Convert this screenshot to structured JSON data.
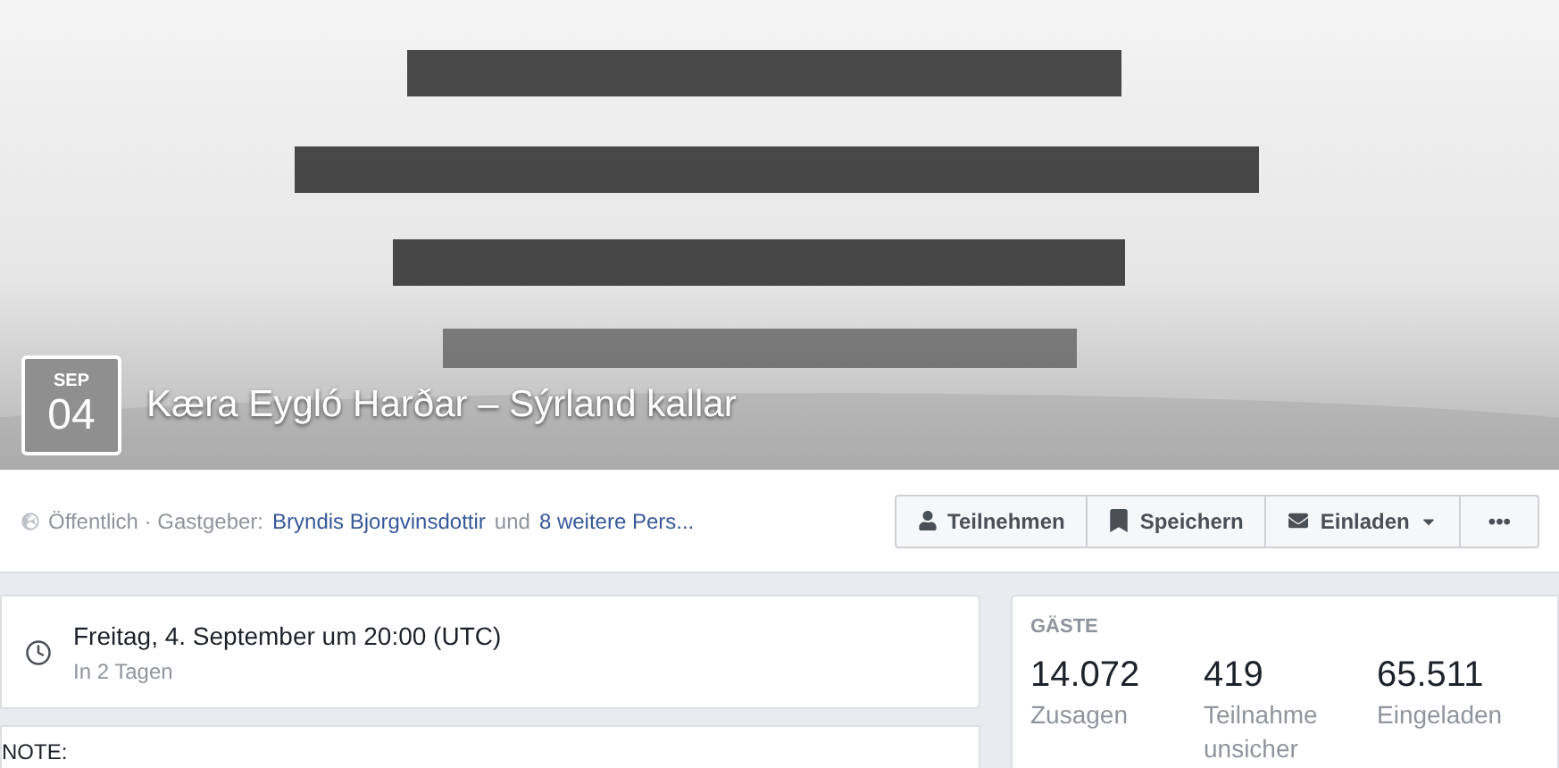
{
  "event": {
    "month": "SEP",
    "day": "04",
    "title": "Kæra Eygló Harðar – Sýrland kallar"
  },
  "info": {
    "privacy": "Öffentlich · Gastgeber:",
    "host": "Bryndis Bjorgvinsdottir",
    "joiner": "und",
    "others": "8 weitere Pers..."
  },
  "actions": [
    {
      "kind": "join",
      "label": "Teilnehmen"
    },
    {
      "kind": "save",
      "label": "Speichern"
    },
    {
      "kind": "invite",
      "label": "Einladen"
    },
    {
      "kind": "more",
      "label": "•••"
    }
  ],
  "time": {
    "date": "Freitag, 4. September um 20:00 (UTC)",
    "relative": "In 2 Tagen"
  },
  "note": {
    "heading": "NOTE:"
  },
  "guests": {
    "heading": "GÄSTE",
    "stats": [
      {
        "value": "14.072",
        "label": "Zusagen"
      },
      {
        "value": "419",
        "label": "Teilnahme unsicher"
      },
      {
        "value": "65.511",
        "label": "Eingeladen"
      }
    ]
  }
}
